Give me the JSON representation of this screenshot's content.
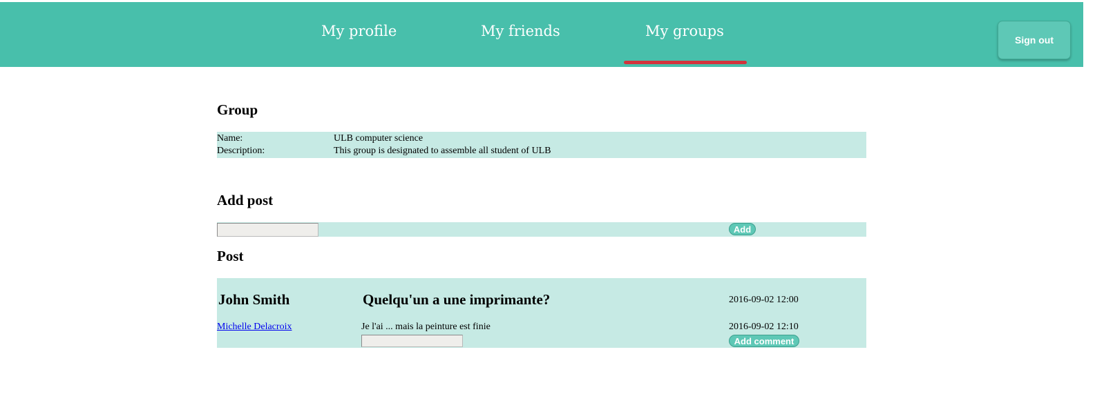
{
  "nav": {
    "items": [
      {
        "label": "My profile"
      },
      {
        "label": "My friends"
      },
      {
        "label": "My groups"
      }
    ],
    "active": "My groups",
    "signout_label": "Sign out"
  },
  "group": {
    "heading": "Group",
    "name_label": "Name:",
    "name_value": "ULB computer science",
    "description_label": "Description:",
    "description_value": "This group is designated to assemble all student of ULB"
  },
  "add_post": {
    "heading": "Add post",
    "input_value": "",
    "add_label": "Add"
  },
  "posts": {
    "heading": "Post",
    "items": [
      {
        "author": "John Smith",
        "title": "Quelqu'un a une imprimante?",
        "timestamp": "2016-09-02 12:00",
        "comments": [
          {
            "author": "Michelle Delacroix",
            "text": "Je l'ai ... mais la peinture est finie",
            "timestamp": "2016-09-02 12:10"
          }
        ],
        "comment_input_value": "",
        "add_comment_label": "Add comment"
      }
    ]
  },
  "colors": {
    "nav_bg": "#48bfab",
    "active_underline": "#d2333c",
    "band_bg": "#c6eae4",
    "button_bg": "#5ec8b6"
  }
}
